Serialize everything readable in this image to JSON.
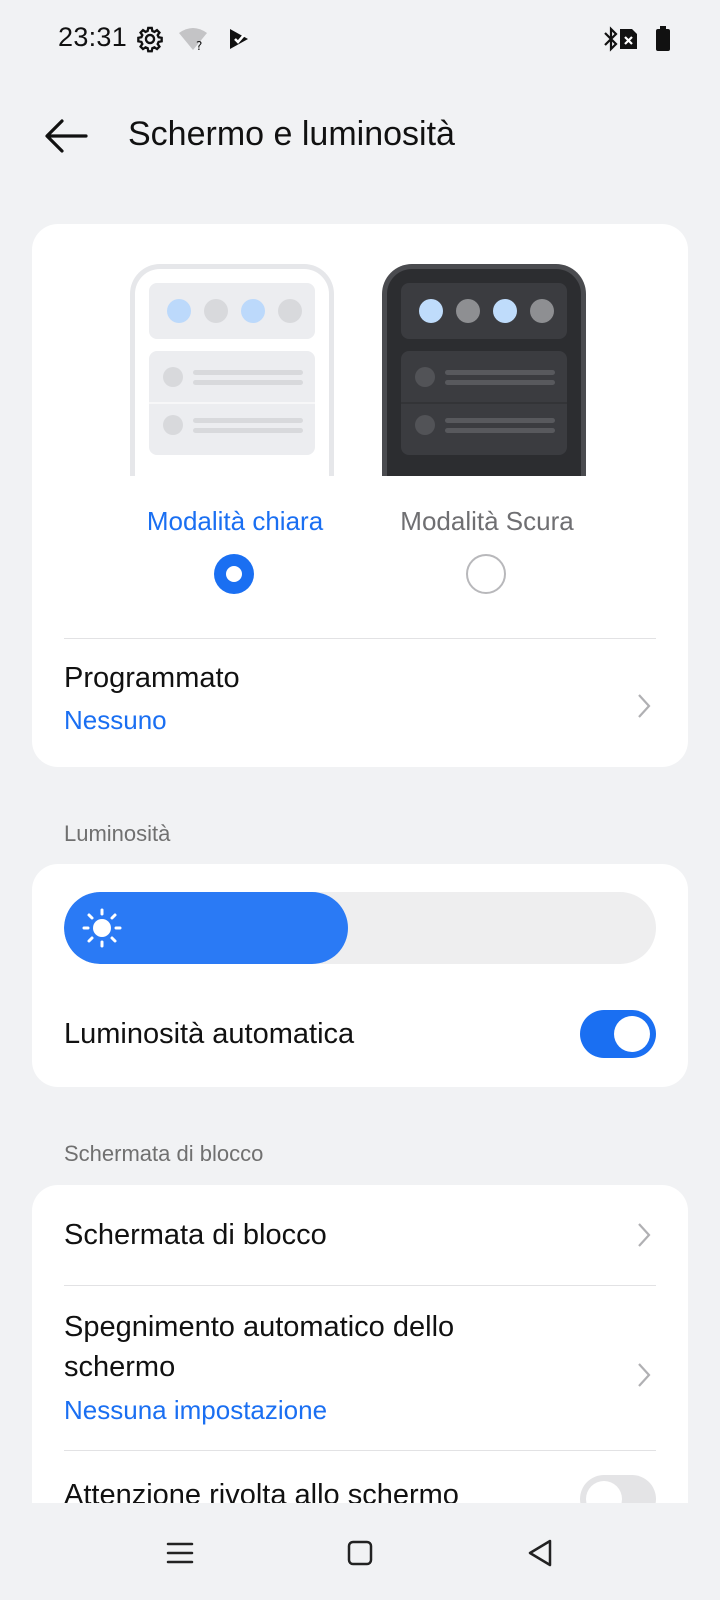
{
  "status_bar": {
    "time": "23:31",
    "icons": [
      "gear-icon",
      "wifi-unknown-icon",
      "play-store-icon",
      "bluetooth-icon",
      "sim-error-icon",
      "battery-icon"
    ]
  },
  "header": {
    "back_icon": "arrow-left-icon",
    "title": "Schermo e luminosità"
  },
  "theme": {
    "options": [
      {
        "label": "Modalità chiara",
        "selected": true
      },
      {
        "label": "Modalità Scura",
        "selected": false
      }
    ],
    "schedule": {
      "title": "Programmato",
      "value": "Nessuno"
    }
  },
  "brightness": {
    "section_label": "Luminosità",
    "level_percent": 48,
    "auto": {
      "label": "Luminosità automatica",
      "enabled": true
    }
  },
  "lock": {
    "section_label": "Schermata di blocco",
    "items": [
      {
        "title": "Schermata di blocco"
      },
      {
        "title": "Spegnimento automatico dello schermo",
        "value": "Nessuna impostazione"
      },
      {
        "title": "Attenzione rivolta allo schermo",
        "enabled": false
      }
    ]
  },
  "colors": {
    "accent": "#1a6ff2",
    "slider_fill": "#2a7af5",
    "background": "#f1f2f4"
  },
  "navbar": {
    "icons": [
      "menu-icon",
      "home-square-icon",
      "back-triangle-icon"
    ]
  }
}
